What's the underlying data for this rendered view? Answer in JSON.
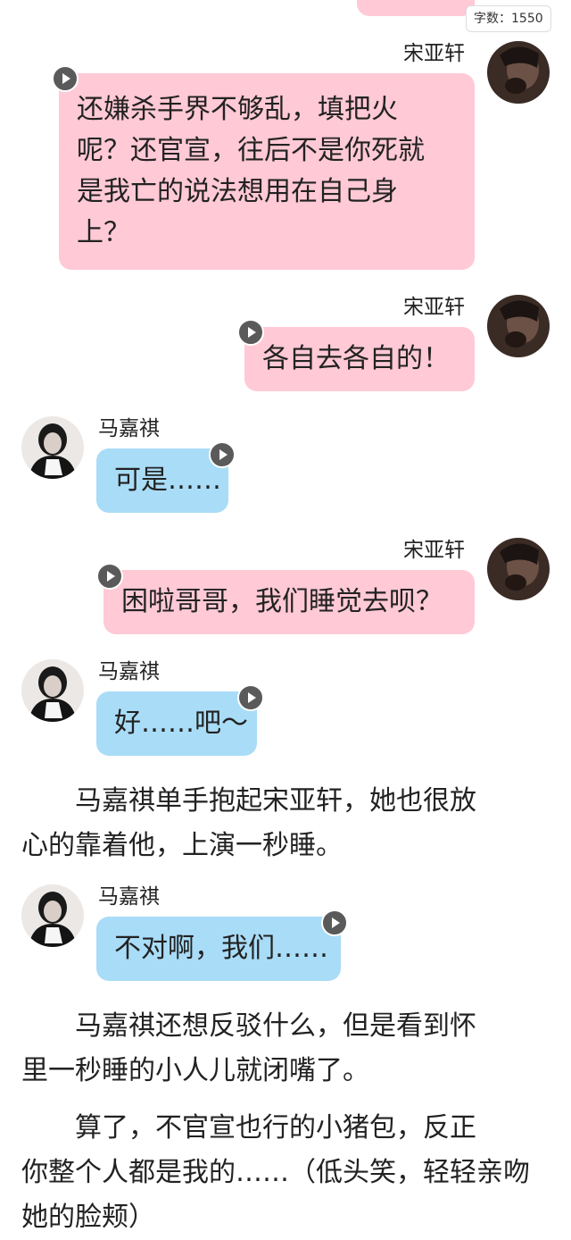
{
  "counter": {
    "label": "字数：1550"
  },
  "colors": {
    "pink_bubble": "#ffc9d6",
    "blue_bubble": "#a9dcf7",
    "play_icon": "#5a5a5a"
  },
  "messages": [
    {
      "sender": "宋亚轩",
      "text_lines": [
        "还嫌杀手界不够乱，填把火",
        "呢？还官宣，往后不是你死就",
        "是我亡的说法想用在自己身",
        "上？"
      ]
    },
    {
      "sender": "宋亚轩",
      "text": "各自去各自的！"
    },
    {
      "sender": "马嘉祺",
      "text": "可是……"
    },
    {
      "sender": "宋亚轩",
      "text": "困啦哥哥，我们睡觉去呗？"
    },
    {
      "sender": "马嘉祺",
      "text": "好……吧～"
    },
    {
      "sender": "马嘉祺",
      "text": "不对啊，我们……"
    }
  ],
  "narration": [
    {
      "lines": [
        "　　马嘉祺单手抱起宋亚轩，她也很放",
        "心的靠着他，上演一秒睡。"
      ]
    },
    {
      "lines": [
        "　　马嘉祺还想反驳什么，但是看到怀",
        "里一秒睡的小人儿就闭嘴了。"
      ]
    },
    {
      "lines": [
        "　　算了，不官宣也行的小猪包，反正",
        "你整个人都是我的……（低头笑，轻轻亲吻",
        "她的脸颊）"
      ]
    }
  ]
}
